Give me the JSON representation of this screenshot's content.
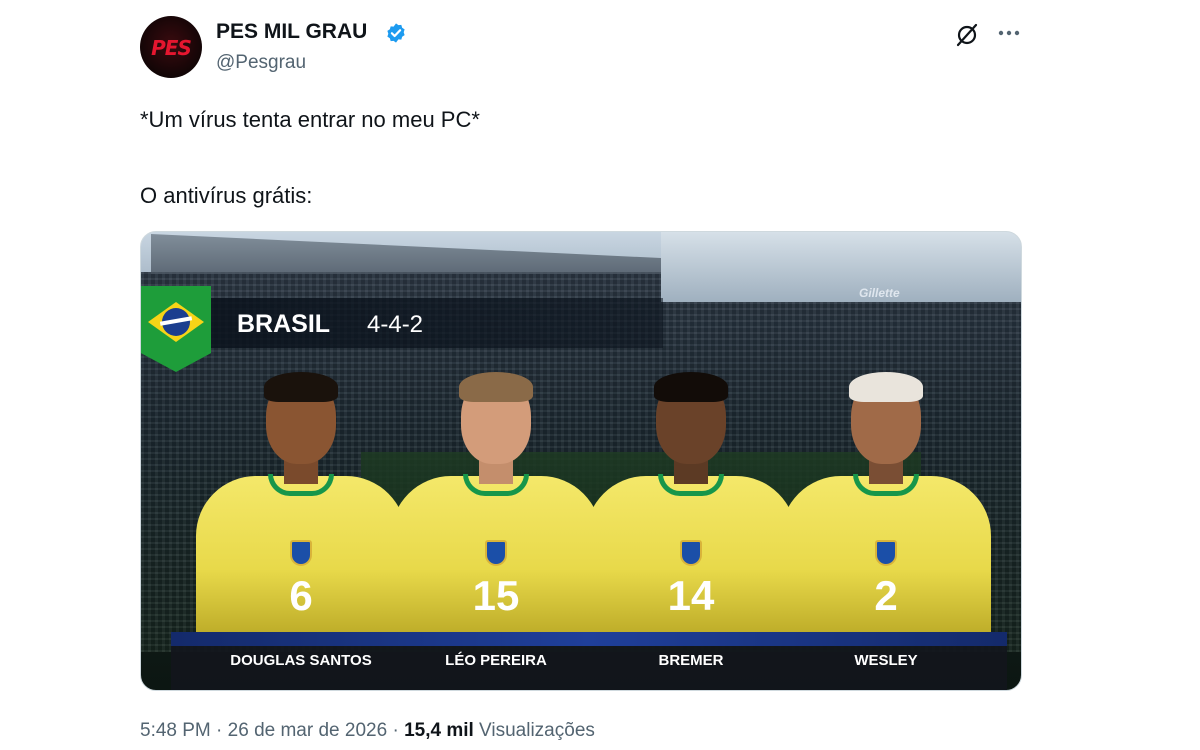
{
  "author": {
    "display_name": "PES MIL GRAU",
    "handle": "@Pesgrau",
    "avatar_text": "PES",
    "verified": true
  },
  "tweet": {
    "line1": "*Um vírus tenta entrar no meu PC*",
    "line2": "O antivírus grátis:"
  },
  "media": {
    "sponsor": "Gillette",
    "team": "BRASIL",
    "formation": "4-4-2",
    "players": [
      {
        "number": "6",
        "name": "DOUGLAS SANTOS"
      },
      {
        "number": "15",
        "name": "LÉO PEREIRA"
      },
      {
        "number": "14",
        "name": "BREMER"
      },
      {
        "number": "2",
        "name": "WESLEY"
      }
    ]
  },
  "meta": {
    "time": "5:48 PM",
    "sep1": " · ",
    "date": "26 de mar de 2026",
    "sep2": " · ",
    "views_count": "15,4 mil",
    "views_label": " Visualizações"
  },
  "icons": {
    "verified": "verified-badge-icon",
    "grok": "grok-icon",
    "more": "more-options-icon"
  },
  "colors": {
    "verified_blue": "#1d9bf0",
    "secondary_text": "#536471",
    "brazil_green": "#1e9d3a",
    "brazil_yellow": "#f7d417",
    "brazil_blue": "#1b3e8f"
  }
}
